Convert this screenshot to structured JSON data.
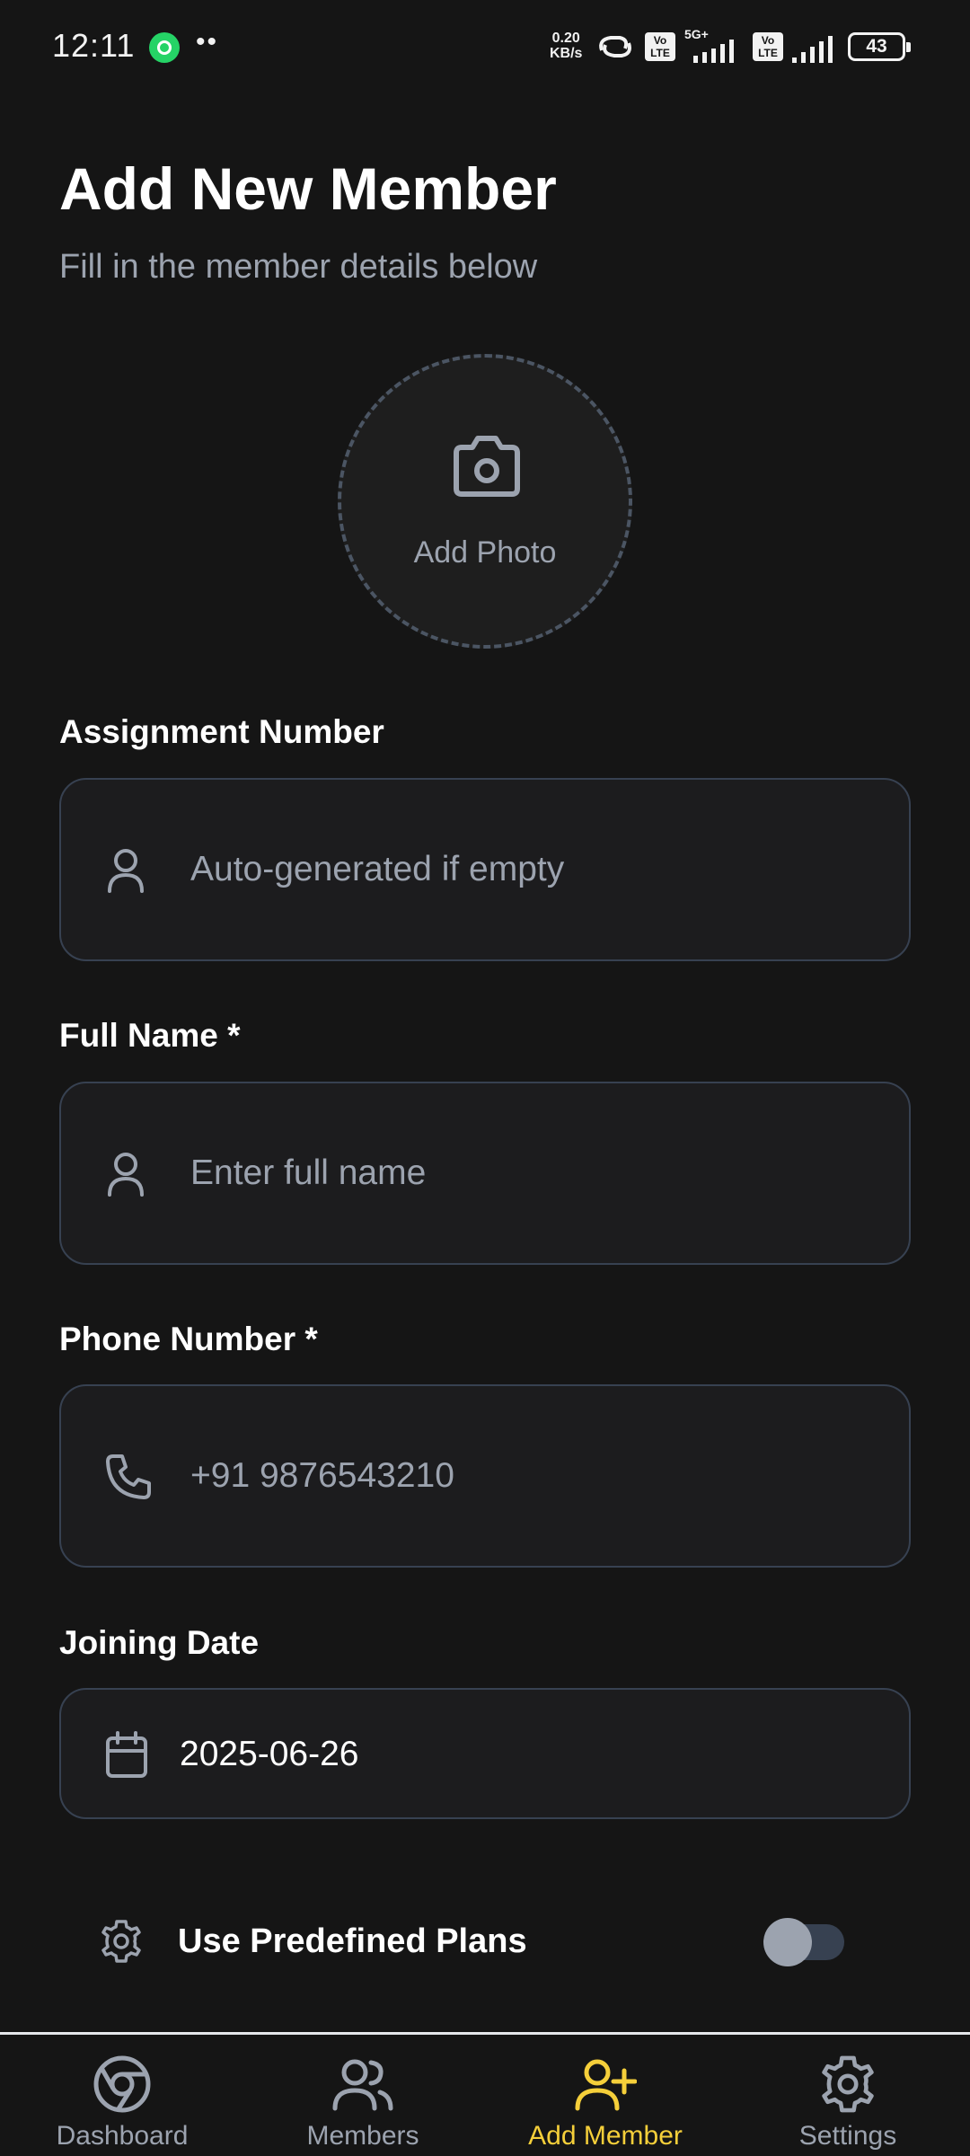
{
  "status_bar": {
    "time": "12:11",
    "dots": "••",
    "net_speed_value": "0.20",
    "net_speed_unit": "KB/s",
    "volte_1": "Vo LTE",
    "volte_2": "Vo LTE",
    "network_type": "5G+",
    "battery": "43"
  },
  "header": {
    "title": "Add New Member",
    "subtitle": "Fill in the member details below"
  },
  "photo": {
    "label": "Add Photo"
  },
  "form": {
    "assignment": {
      "label": "Assignment Number",
      "placeholder": "Auto-generated if empty",
      "icon": "person-icon"
    },
    "full_name": {
      "label": "Full Name *",
      "placeholder": "Enter full name",
      "icon": "person-icon"
    },
    "phone": {
      "label": "Phone Number *",
      "placeholder": "+91 9876543210",
      "icon": "phone-icon"
    },
    "joining_date": {
      "label": "Joining Date",
      "value": "2025-06-26",
      "icon": "calendar-icon"
    },
    "predefined_plans": {
      "label": "Use Predefined Plans",
      "enabled": false,
      "icon": "gear-icon"
    }
  },
  "bottom_nav": {
    "items": [
      {
        "label": "Dashboard",
        "icon": "chrome-icon",
        "active": false
      },
      {
        "label": "Members",
        "icon": "users-icon",
        "active": false
      },
      {
        "label": "Add Member",
        "icon": "user-plus-icon",
        "active": true
      },
      {
        "label": "Settings",
        "icon": "gear-icon",
        "active": false
      }
    ]
  },
  "colors": {
    "background": "#151515",
    "field_background": "#1c1c1e",
    "border": "#374151",
    "muted_text": "#9ca3af",
    "accent": "#f5cf3a"
  }
}
